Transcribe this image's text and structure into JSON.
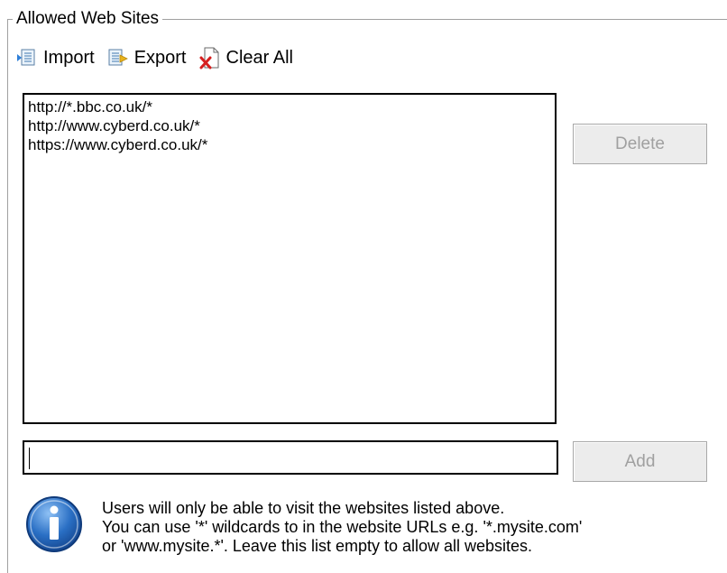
{
  "group": {
    "title": "Allowed Web Sites"
  },
  "toolbar": {
    "import_label": "Import",
    "export_label": "Export",
    "clear_all_label": "Clear All",
    "icons": {
      "import": "import-icon",
      "export": "export-icon",
      "clear_all": "clear-all-icon"
    }
  },
  "site_list": {
    "items": [
      "http://*.bbc.co.uk/*",
      "http://www.cyberd.co.uk/*",
      "https://www.cyberd.co.uk/*"
    ]
  },
  "buttons": {
    "delete_label": "Delete",
    "add_label": "Add",
    "disabled_text_color": "#a0a0a0"
  },
  "url_input": {
    "value": ""
  },
  "info": {
    "icon": "info-icon",
    "lines": [
      "Users will only be able to visit the websites listed above.",
      "You can use '*' wildcards to in the website URLs e.g. '*.mysite.com'",
      "or 'www.mysite.*'.  Leave this list empty to allow all websites."
    ]
  },
  "colors": {
    "frame": "#a0a0a0",
    "button_face": "#ececec",
    "info_blue": "#1f5fb0"
  }
}
